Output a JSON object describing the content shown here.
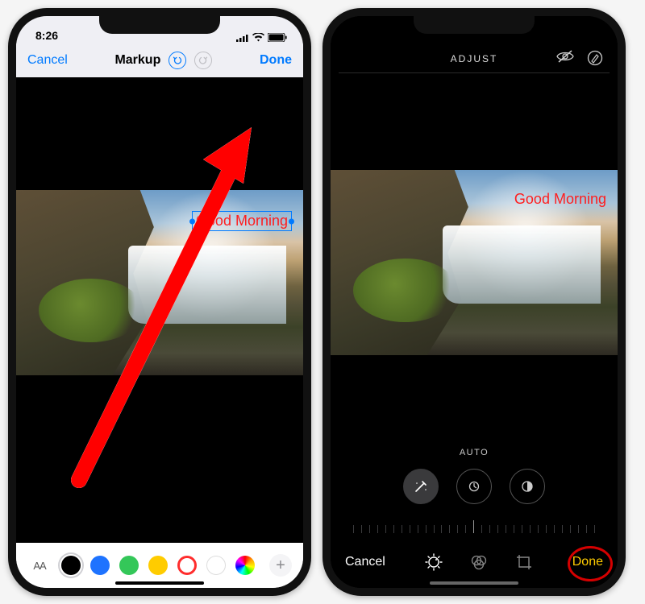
{
  "left": {
    "status_time": "8:26",
    "cancel": "Cancel",
    "title": "Markup",
    "done": "Done",
    "text_overlay": "Good Morning",
    "aa_label": "AA",
    "colors": [
      {
        "name": "black",
        "hex": "#000000",
        "selected": true
      },
      {
        "name": "blue",
        "hex": "#1e73ff"
      },
      {
        "name": "green",
        "hex": "#34c759"
      },
      {
        "name": "yellow",
        "hex": "#ffcc00"
      },
      {
        "name": "red",
        "hex": "#ff3b30",
        "ring": true
      },
      {
        "name": "white",
        "hex": "#ffffff",
        "border": true
      },
      {
        "name": "rainbow",
        "hex": "rainbow"
      }
    ],
    "plus": "+"
  },
  "right": {
    "header": "ADJUST",
    "text_overlay": "Good Morning",
    "auto": "AUTO",
    "cancel": "Cancel",
    "done": "Done"
  }
}
